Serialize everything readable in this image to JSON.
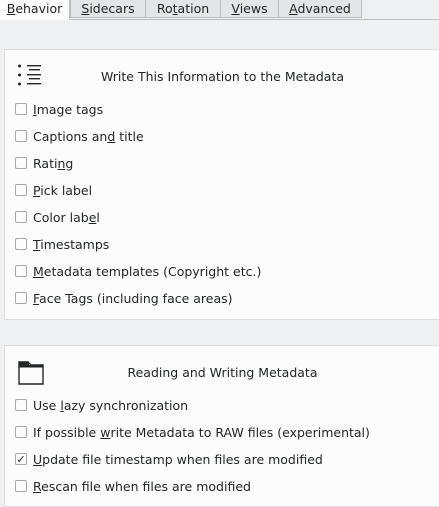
{
  "tabs": [
    {
      "label_pre": "",
      "label_ul": "B",
      "label_post": "ehavior",
      "active": true
    },
    {
      "label_pre": "",
      "label_ul": "S",
      "label_post": "idecars",
      "active": false
    },
    {
      "label_pre": "Ro",
      "label_ul": "t",
      "label_post": "ation",
      "active": false
    },
    {
      "label_pre": "",
      "label_ul": "V",
      "label_post": "iews",
      "active": false
    },
    {
      "label_pre": "",
      "label_ul": "A",
      "label_post": "dvanced",
      "active": false
    }
  ],
  "write_group": {
    "title": "Write This Information to the Metadata",
    "icon": "list-icon",
    "options": [
      {
        "pre": "",
        "ul": "I",
        "post": "mage tags",
        "checked": false
      },
      {
        "pre": "Captions an",
        "ul": "d",
        "post": " title",
        "checked": false
      },
      {
        "pre": "Rati",
        "ul": "n",
        "post": "g",
        "checked": false
      },
      {
        "pre": "",
        "ul": "P",
        "post": "ick label",
        "checked": false
      },
      {
        "pre": "Color lab",
        "ul": "e",
        "post": "l",
        "checked": false
      },
      {
        "pre": "",
        "ul": "T",
        "post": "imestamps",
        "checked": false
      },
      {
        "pre": "",
        "ul": "M",
        "post": "etadata templates (Copyright etc.)",
        "checked": false
      },
      {
        "pre": "",
        "ul": "F",
        "post": "ace Tags (including face areas)",
        "checked": false
      }
    ]
  },
  "rw_group": {
    "title": "Reading and Writing Metadata",
    "icon": "folder-icon",
    "options": [
      {
        "pre": "Use ",
        "ul": "l",
        "post": "azy synchronization",
        "checked": false
      },
      {
        "pre": "If possible ",
        "ul": "w",
        "post": "rite Metadata to RAW files (experimental)",
        "checked": false
      },
      {
        "pre": "",
        "ul": "U",
        "post": "pdate file timestamp when files are modified",
        "checked": true
      },
      {
        "pre": "",
        "ul": "R",
        "post": "escan file when files are modified",
        "checked": false
      }
    ]
  },
  "checkmark": "✓"
}
